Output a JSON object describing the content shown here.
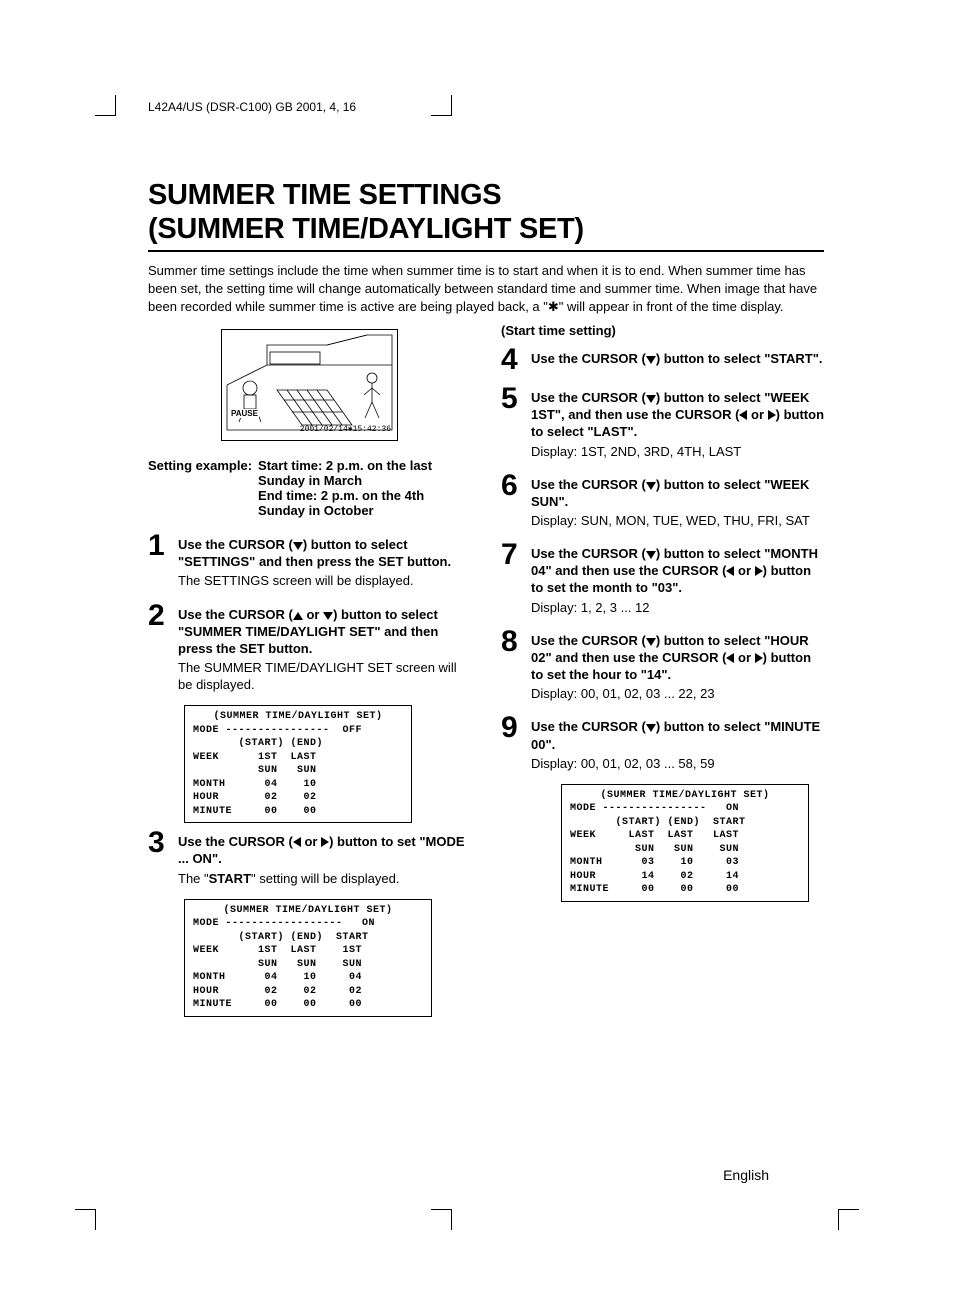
{
  "header": "L42A4/US (DSR-C100)   GB   2001, 4, 16",
  "title_line1": "SUMMER TIME SETTINGS",
  "title_line2": "(SUMMER TIME/DAYLIGHT SET)",
  "intro": "Summer time settings include the time when summer time is to start and when it is to end. When summer time has been set, the setting time will change automatically between standard time and summer time. When image that have been recorded while summer time is active are being played back, a \"✱\" will appear in front of the time display.",
  "illustration": {
    "pause_label": "PAUSE",
    "timestamp": "2001/02/14✱15:42:36"
  },
  "example": {
    "label": "Setting example:",
    "line1": "Start time: 2 p.m. on the last Sunday in March",
    "line2": "End time: 2 p.m. on the 4th Sunday in October"
  },
  "steps_left": [
    {
      "num": "1",
      "head_pre": "Use the CURSOR (",
      "arrow": "down",
      "head_post": ") button to select \"SETTINGS\" and then press the SET button.",
      "note": "The SETTINGS screen will be displayed."
    },
    {
      "num": "2",
      "head_pre": "Use the CURSOR (",
      "arrow": "updown",
      "head_post": ") button to select \"SUMMER TIME/DAYLIGHT SET\" and then press the SET button.",
      "note": "The SUMMER TIME/DAYLIGHT SET screen will be displayed."
    },
    {
      "num": "3",
      "head_pre": "Use the CURSOR (",
      "arrow": "leftright",
      "head_post": ") button to set \"MODE ... ON\".",
      "note_html": "The \"<b>START</b>\" setting will be displayed."
    }
  ],
  "right_subhead": "(Start time setting)",
  "steps_right": [
    {
      "num": "4",
      "head_pre": "Use the CURSOR (",
      "arrow": "down",
      "head_post": ") button to select \"START\"."
    },
    {
      "num": "5",
      "head_pre": "Use the CURSOR (",
      "arrow": "down",
      "head_mid": ") button to select \"WEEK 1ST\", and then use the CURSOR (",
      "arrow2": "leftright",
      "head_post": ") button to select \"LAST\".",
      "note": "Display: 1ST, 2ND, 3RD, 4TH, LAST"
    },
    {
      "num": "6",
      "head_pre": "Use the CURSOR (",
      "arrow": "down",
      "head_post": ") button to select \"WEEK SUN\".",
      "note": "Display: SUN, MON, TUE, WED, THU, FRI, SAT"
    },
    {
      "num": "7",
      "head_pre": "Use the CURSOR (",
      "arrow": "down",
      "head_mid": ") button to select \"MONTH 04\" and then use the CURSOR (",
      "arrow2": "leftright",
      "head_post": ") button to set the month to \"03\".",
      "note": "Display: 1, 2, 3 ... 12"
    },
    {
      "num": "8",
      "head_pre": "Use the CURSOR (",
      "arrow": "down",
      "head_mid": ") button to select \"HOUR 02\" and then use the CURSOR (",
      "arrow2": "leftright",
      "head_post": ") button to set the hour to \"14\".",
      "note": "Display: 00, 01, 02, 03 ... 22, 23"
    },
    {
      "num": "9",
      "head_pre": "Use the CURSOR (",
      "arrow": "down",
      "head_post": ") button to select \"MINUTE 00\".",
      "note": "Display: 00, 01, 02, 03 ... 58, 59"
    }
  ],
  "screen1": {
    "title": "(SUMMER TIME/DAYLIGHT SET)",
    "lines": [
      "MODE ----------------  OFF",
      "       (START) (END)",
      "WEEK      1ST  LAST",
      "          SUN   SUN",
      "MONTH      04    10",
      "HOUR       02    02",
      "MINUTE     00    00"
    ]
  },
  "screen2": {
    "title": "(SUMMER TIME/DAYLIGHT SET)",
    "lines": [
      "MODE ------------------   ON",
      "       (START) (END)  START",
      "WEEK      1ST  LAST    1ST",
      "          SUN   SUN    SUN",
      "MONTH      04    10     04",
      "HOUR       02    02     02",
      "MINUTE     00    00     00"
    ]
  },
  "screen3": {
    "title": "(SUMMER TIME/DAYLIGHT SET)",
    "lines": [
      "MODE ----------------   ON",
      "       (START) (END)  START",
      "WEEK     LAST  LAST   LAST",
      "          SUN   SUN    SUN",
      "MONTH      03    10     03",
      "HOUR       14    02     14",
      "MINUTE     00    00     00"
    ]
  },
  "footer_lang": "English"
}
